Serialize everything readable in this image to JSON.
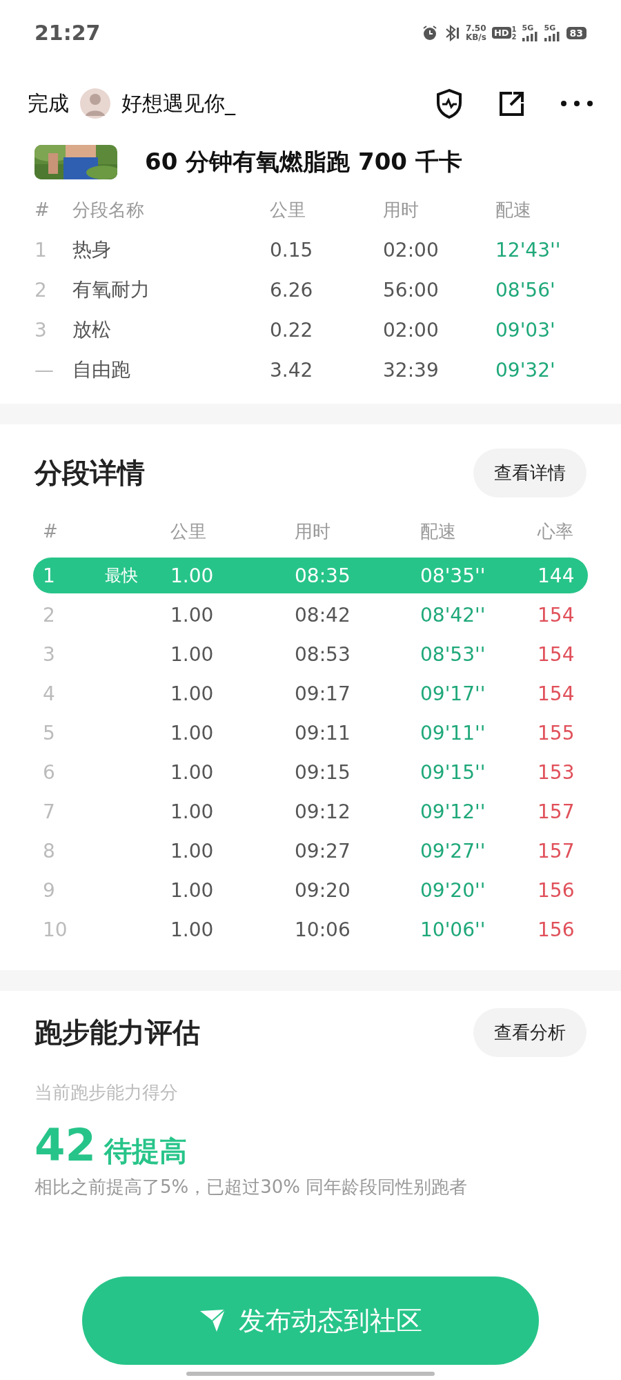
{
  "status_bar": {
    "time": "21:27",
    "net_speed": "7.50",
    "net_unit": "KB/s",
    "hd": "HD",
    "hd_sup": "1",
    "hd_sub": "2",
    "networks": [
      "5G",
      "5G"
    ],
    "battery": "83"
  },
  "header": {
    "done": "完成",
    "user_name": "好想遇见你_"
  },
  "workout": {
    "title": "60 分钟有氧燃脂跑 700 千卡"
  },
  "segments": {
    "columns": [
      "#",
      "分段名称",
      "公里",
      "用时",
      "配速"
    ],
    "rows": [
      {
        "index": "1",
        "name": "热身",
        "km": "0.15",
        "time": "02:00",
        "pace": "12'43''"
      },
      {
        "index": "2",
        "name": "有氧耐力",
        "km": "6.26",
        "time": "56:00",
        "pace": "08'56'"
      },
      {
        "index": "3",
        "name": "放松",
        "km": "0.22",
        "time": "02:00",
        "pace": "09'03'"
      },
      {
        "index": "—",
        "name": "自由跑",
        "km": "3.42",
        "time": "32:39",
        "pace": "09'32'"
      }
    ]
  },
  "splits": {
    "title": "分段详情",
    "button": "查看详情",
    "columns": [
      "#",
      "公里",
      "用时",
      "配速",
      "心率"
    ],
    "rows": [
      {
        "index": "1",
        "badge": "最快",
        "km": "1.00",
        "time": "08:35",
        "pace": "08'35''",
        "hr": "144",
        "selected": true
      },
      {
        "index": "2",
        "km": "1.00",
        "time": "08:42",
        "pace": "08'42''",
        "hr": "154",
        "selected": false
      },
      {
        "index": "3",
        "km": "1.00",
        "time": "08:53",
        "pace": "08'53''",
        "hr": "154",
        "selected": false
      },
      {
        "index": "4",
        "km": "1.00",
        "time": "09:17",
        "pace": "09'17''",
        "hr": "154",
        "selected": false
      },
      {
        "index": "5",
        "km": "1.00",
        "time": "09:11",
        "pace": "09'11''",
        "hr": "155",
        "selected": false
      },
      {
        "index": "6",
        "km": "1.00",
        "time": "09:15",
        "pace": "09'15''",
        "hr": "153",
        "selected": false
      },
      {
        "index": "7",
        "km": "1.00",
        "time": "09:12",
        "pace": "09'12''",
        "hr": "157",
        "selected": false
      },
      {
        "index": "8",
        "km": "1.00",
        "time": "09:27",
        "pace": "09'27''",
        "hr": "157",
        "selected": false
      },
      {
        "index": "9",
        "km": "1.00",
        "time": "09:20",
        "pace": "09'20''",
        "hr": "156",
        "selected": false
      },
      {
        "index": "10",
        "km": "1.00",
        "time": "10:06",
        "pace": "10'06''",
        "hr": "156",
        "selected": false
      }
    ]
  },
  "ability": {
    "title": "跑步能力评估",
    "button": "查看分析",
    "label": "当前跑步能力得分",
    "score": "42",
    "rating": "待提高",
    "summary": "相比之前提高了5%，已超过30% 同年龄段同性别跑者"
  },
  "post_button": "发布动态到社区"
}
